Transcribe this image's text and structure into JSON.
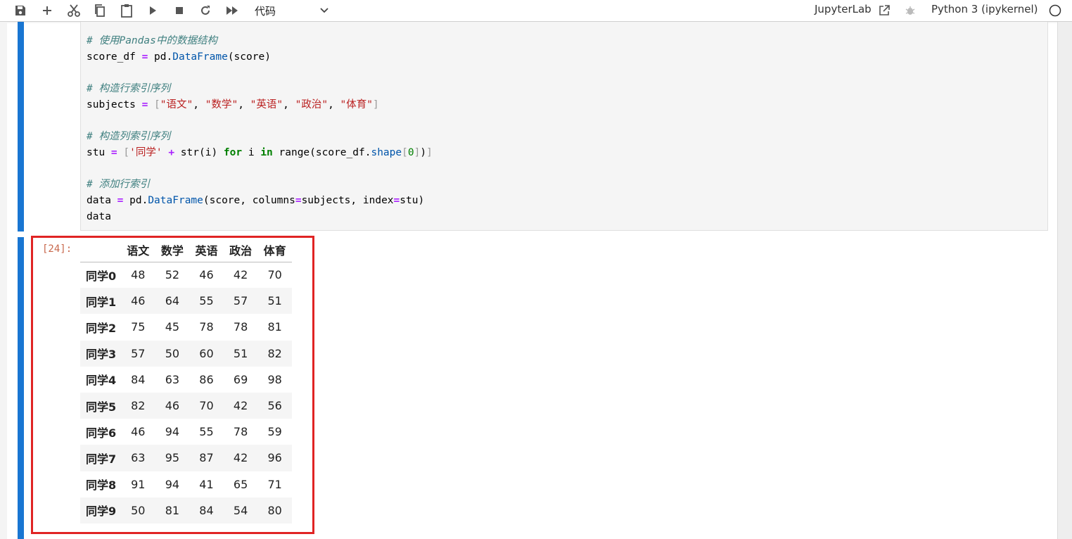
{
  "toolbar": {
    "buttons": [
      {
        "name": "save-icon"
      },
      {
        "name": "add-cell-icon"
      },
      {
        "name": "cut-icon"
      },
      {
        "name": "copy-icon"
      },
      {
        "name": "paste-icon"
      },
      {
        "name": "run-icon"
      },
      {
        "name": "stop-icon"
      },
      {
        "name": "restart-icon"
      },
      {
        "name": "run-all-icon"
      }
    ],
    "cell_type": "代码",
    "jupyterlab_link": "JupyterLab",
    "kernel_name": "Python 3 (ipykernel)"
  },
  "code_cell": {
    "lines": [
      [
        {
          "t": "# 使用Pandas中的数据结构",
          "c": "c-cm"
        }
      ],
      [
        {
          "t": "score_df ",
          "c": "c-nm"
        },
        {
          "t": "=",
          "c": "c-op"
        },
        {
          "t": " pd.",
          "c": "c-nm"
        },
        {
          "t": "DataFrame",
          "c": "c-at"
        },
        {
          "t": "(score)",
          "c": "c-nm"
        }
      ],
      [],
      [
        {
          "t": "# 构造行索引序列",
          "c": "c-cm"
        }
      ],
      [
        {
          "t": "subjects ",
          "c": "c-nm"
        },
        {
          "t": "=",
          "c": "c-op"
        },
        {
          "t": " ",
          "c": "c-nm"
        },
        {
          "t": "[",
          "c": "c-br"
        },
        {
          "t": "\"语文\"",
          "c": "c-st"
        },
        {
          "t": ", ",
          "c": "c-nm"
        },
        {
          "t": "\"数学\"",
          "c": "c-st"
        },
        {
          "t": ", ",
          "c": "c-nm"
        },
        {
          "t": "\"英语\"",
          "c": "c-st"
        },
        {
          "t": ", ",
          "c": "c-nm"
        },
        {
          "t": "\"政治\"",
          "c": "c-st"
        },
        {
          "t": ", ",
          "c": "c-nm"
        },
        {
          "t": "\"体育\"",
          "c": "c-st"
        },
        {
          "t": "]",
          "c": "c-br"
        }
      ],
      [],
      [
        {
          "t": "# 构造列索引序列",
          "c": "c-cm"
        }
      ],
      [
        {
          "t": "stu ",
          "c": "c-nm"
        },
        {
          "t": "=",
          "c": "c-op"
        },
        {
          "t": " ",
          "c": "c-nm"
        },
        {
          "t": "[",
          "c": "c-br"
        },
        {
          "t": "'同学'",
          "c": "c-st"
        },
        {
          "t": " ",
          "c": "c-nm"
        },
        {
          "t": "+",
          "c": "c-op"
        },
        {
          "t": " str(i) ",
          "c": "c-nm"
        },
        {
          "t": "for",
          "c": "c-kw"
        },
        {
          "t": " i ",
          "c": "c-nm"
        },
        {
          "t": "in",
          "c": "c-kw"
        },
        {
          "t": " range(score_df.",
          "c": "c-nm"
        },
        {
          "t": "shape",
          "c": "c-at"
        },
        {
          "t": "[",
          "c": "c-br"
        },
        {
          "t": "0",
          "c": "c-nu"
        },
        {
          "t": "]",
          "c": "c-br"
        },
        {
          "t": ")",
          "c": "c-nm"
        },
        {
          "t": "]",
          "c": "c-br"
        }
      ],
      [],
      [
        {
          "t": "# 添加行索引",
          "c": "c-cm"
        }
      ],
      [
        {
          "t": "data ",
          "c": "c-nm"
        },
        {
          "t": "=",
          "c": "c-op"
        },
        {
          "t": " pd.",
          "c": "c-nm"
        },
        {
          "t": "DataFrame",
          "c": "c-at"
        },
        {
          "t": "(score, columns",
          "c": "c-nm"
        },
        {
          "t": "=",
          "c": "c-op"
        },
        {
          "t": "subjects, index",
          "c": "c-nm"
        },
        {
          "t": "=",
          "c": "c-op"
        },
        {
          "t": "stu)",
          "c": "c-nm"
        }
      ],
      [
        {
          "t": "data",
          "c": "c-nm"
        }
      ]
    ]
  },
  "output": {
    "prompt": "[24]:",
    "columns": [
      "语文",
      "数学",
      "英语",
      "政治",
      "体育"
    ],
    "rows": [
      {
        "index": "同学0",
        "values": [
          "48",
          "52",
          "46",
          "42",
          "70"
        ]
      },
      {
        "index": "同学1",
        "values": [
          "46",
          "64",
          "55",
          "57",
          "51"
        ]
      },
      {
        "index": "同学2",
        "values": [
          "75",
          "45",
          "78",
          "78",
          "81"
        ]
      },
      {
        "index": "同学3",
        "values": [
          "57",
          "50",
          "60",
          "51",
          "82"
        ]
      },
      {
        "index": "同学4",
        "values": [
          "84",
          "63",
          "86",
          "69",
          "98"
        ]
      },
      {
        "index": "同学5",
        "values": [
          "82",
          "46",
          "70",
          "42",
          "56"
        ]
      },
      {
        "index": "同学6",
        "values": [
          "46",
          "94",
          "55",
          "78",
          "59"
        ]
      },
      {
        "index": "同学7",
        "values": [
          "63",
          "95",
          "87",
          "42",
          "96"
        ]
      },
      {
        "index": "同学8",
        "values": [
          "91",
          "94",
          "41",
          "65",
          "71"
        ]
      },
      {
        "index": "同学9",
        "values": [
          "50",
          "81",
          "84",
          "54",
          "80"
        ]
      }
    ]
  },
  "colors": {
    "collapser": "#1976d2",
    "highlight": "#e02424",
    "prompt": "#c8684c"
  }
}
